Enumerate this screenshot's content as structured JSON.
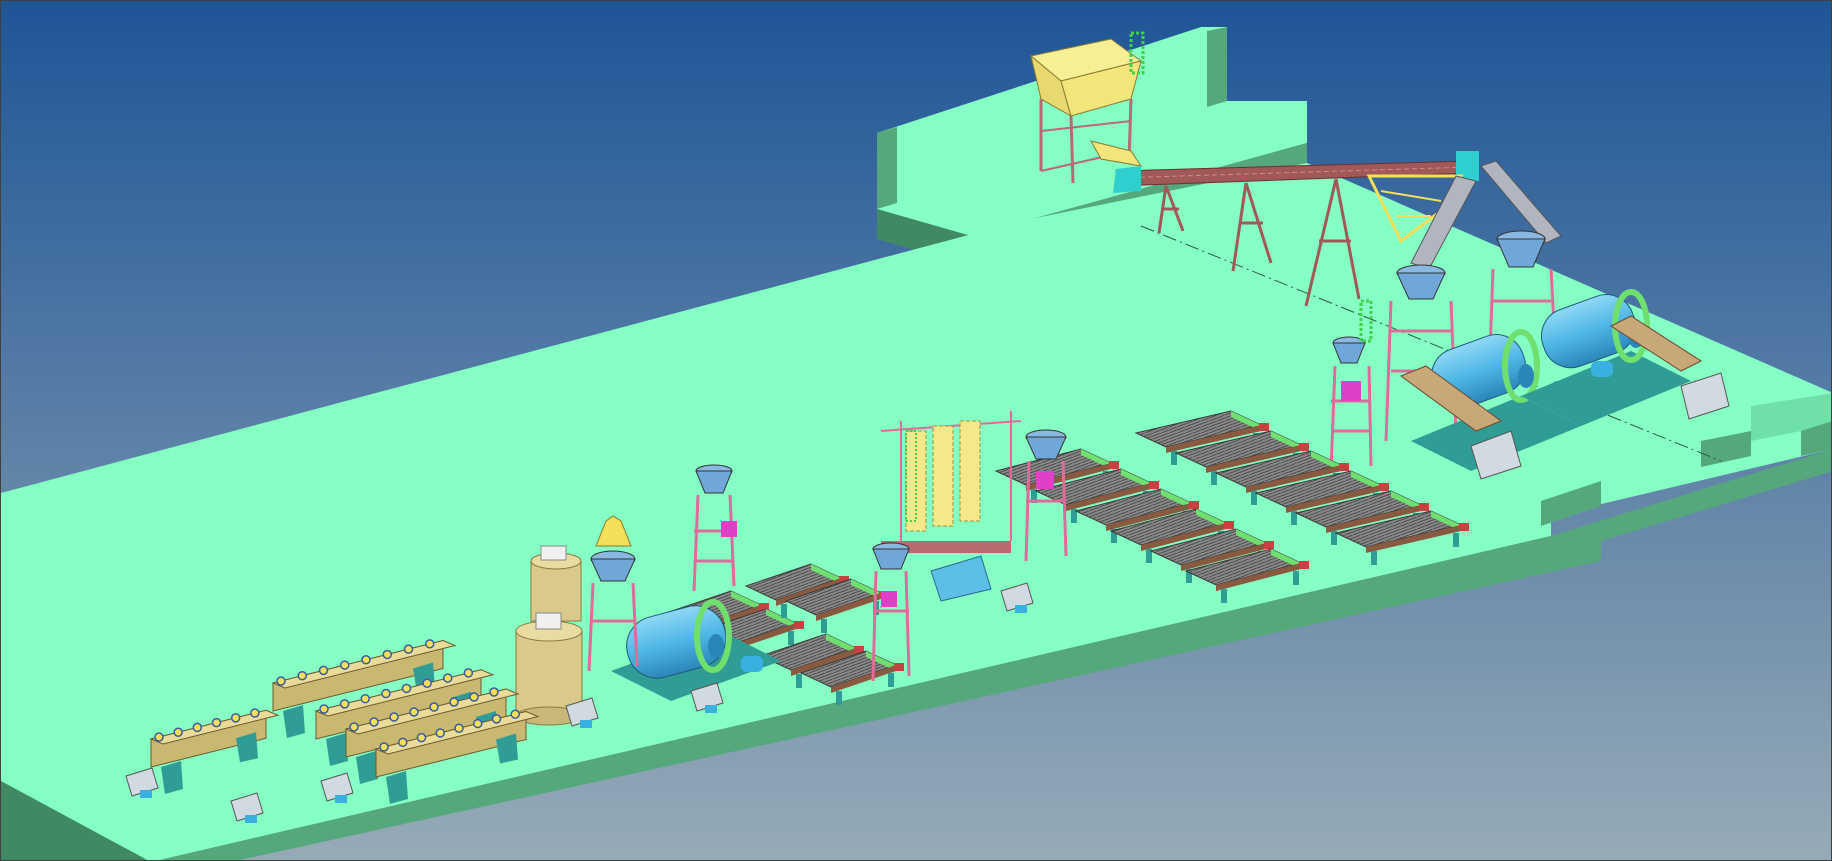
{
  "viewport": {
    "background_top": "#1e5597",
    "background_bottom": "#97abb6"
  },
  "scene": {
    "platform_top": "#85ffc3",
    "platform_side": "#55a87c",
    "platform_dark": "#3f8a62",
    "equipment_colors": {
      "frame": "#b86a70",
      "hopper_yellow": "#f2e57a",
      "tank_beige": "#d9c98b",
      "mill_blue": "#5cbfe8",
      "mill_ring": "#6fe06f",
      "base_teal": "#2f9d95",
      "table_gray": "#7a7a7a",
      "spiral_yellow": "#f3e88a",
      "magenta": "#e040c8",
      "conveyor": "#a05858"
    }
  }
}
